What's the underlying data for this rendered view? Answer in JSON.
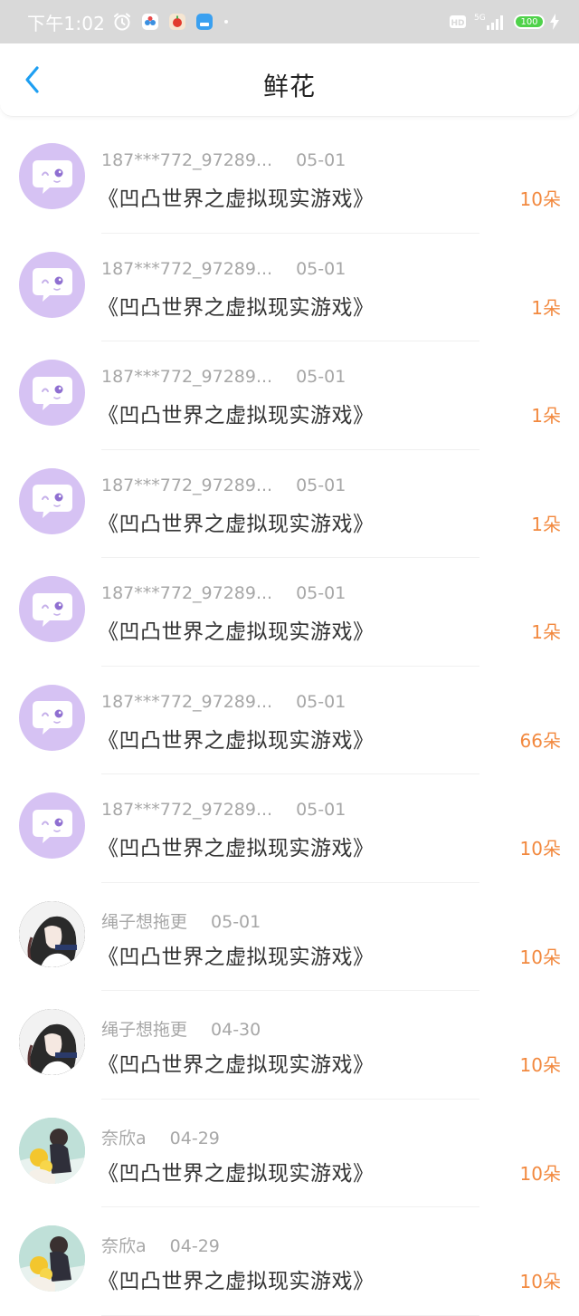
{
  "status_bar": {
    "time": "下午1:02",
    "network": "5G",
    "battery": "100"
  },
  "header": {
    "title": "鲜花"
  },
  "rows": [
    {
      "user": "187***772_97289...",
      "date": "05-01",
      "book": "《凹凸世界之虚拟现实游戏》",
      "count": "10朵",
      "avatar": "default"
    },
    {
      "user": "187***772_97289...",
      "date": "05-01",
      "book": "《凹凸世界之虚拟现实游戏》",
      "count": "1朵",
      "avatar": "default"
    },
    {
      "user": "187***772_97289...",
      "date": "05-01",
      "book": "《凹凸世界之虚拟现实游戏》",
      "count": "1朵",
      "avatar": "default"
    },
    {
      "user": "187***772_97289...",
      "date": "05-01",
      "book": "《凹凸世界之虚拟现实游戏》",
      "count": "1朵",
      "avatar": "default"
    },
    {
      "user": "187***772_97289...",
      "date": "05-01",
      "book": "《凹凸世界之虚拟现实游戏》",
      "count": "1朵",
      "avatar": "default"
    },
    {
      "user": "187***772_97289...",
      "date": "05-01",
      "book": "《凹凸世界之虚拟现实游戏》",
      "count": "66朵",
      "avatar": "default"
    },
    {
      "user": "187***772_97289...",
      "date": "05-01",
      "book": "《凹凸世界之虚拟现实游戏》",
      "count": "10朵",
      "avatar": "default"
    },
    {
      "user": "绳子想拖更",
      "date": "05-01",
      "book": "《凹凸世界之虚拟现实游戏》",
      "count": "10朵",
      "avatar": "photo1"
    },
    {
      "user": "绳子想拖更",
      "date": "04-30",
      "book": "《凹凸世界之虚拟现实游戏》",
      "count": "10朵",
      "avatar": "photo1"
    },
    {
      "user": "奈欣a",
      "date": "04-29",
      "book": "《凹凸世界之虚拟现实游戏》",
      "count": "10朵",
      "avatar": "photo2"
    },
    {
      "user": "奈欣a",
      "date": "04-29",
      "book": "《凹凸世界之虚拟现实游戏》",
      "count": "10朵",
      "avatar": "photo2"
    }
  ],
  "colors": {
    "accent": "#1e9ff2",
    "count": "#f2893f",
    "avatar_default": "#d6c2f3",
    "status_bar": "#d9d9d9"
  },
  "icons": {
    "back": "chevron-left-icon",
    "avatar_default": "chat-bubble-icon"
  }
}
